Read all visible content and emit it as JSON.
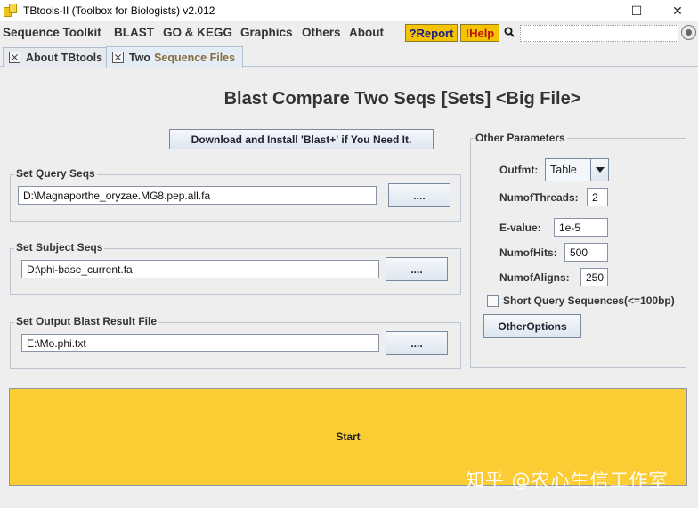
{
  "window": {
    "title": "TBtools-II (Toolbox for Biologists) v2.012",
    "icon": "tbtools-app-icon",
    "controls": [
      "—",
      "☐",
      "✕"
    ]
  },
  "menubar": {
    "items": [
      "Sequence Toolkit",
      "BLAST",
      "GO & KEGG",
      "Graphics",
      "Others",
      "About"
    ],
    "report_label": "?Report",
    "help_label": "!Help",
    "search_icon": "search-icon",
    "search_value": ""
  },
  "tabs": [
    {
      "label": "About TBtools"
    },
    {
      "label_part1": "Two",
      "label_part2": "Sequence Files"
    }
  ],
  "main": {
    "heading": "Blast Compare Two Seqs [Sets] <Big File>",
    "download_label": "Download and Install 'Blast+' if You Need It.",
    "query": {
      "group_label": "Set Query Seqs",
      "value": "D:\\Magnaporthe_oryzae.MG8.pep.all.fa",
      "browse_label": "...."
    },
    "subject": {
      "group_label": "Set Subject Seqs",
      "value": "D:\\phi-base_current.fa",
      "browse_label": "...."
    },
    "output": {
      "group_label": "Set Output Blast Result File",
      "value": "E:\\Mo.phi.txt",
      "browse_label": "...."
    }
  },
  "params": {
    "group_label": "Other Parameters",
    "outfmt_label": "Outfmt:",
    "outfmt_value": "Table",
    "threads_label": "NumofThreads:",
    "threads_value": "2",
    "evalue_label": "E-value:",
    "evalue_value": "1e-5",
    "hits_label": "NumofHits:",
    "hits_value": "500",
    "aligns_label": "NumofAligns:",
    "aligns_value": "250",
    "short_query_label": "Short Query Sequences(<=100bp)",
    "short_query_checked": false,
    "other_options_label": "OtherOptions"
  },
  "start_label": "Start",
  "watermark": "知乎 @农心生信工作室",
  "colors": {
    "start_bg": "#fccc34",
    "menu_button_bg": "#f5c400",
    "report_text": "#1b1b8a",
    "help_text": "#c01010"
  }
}
